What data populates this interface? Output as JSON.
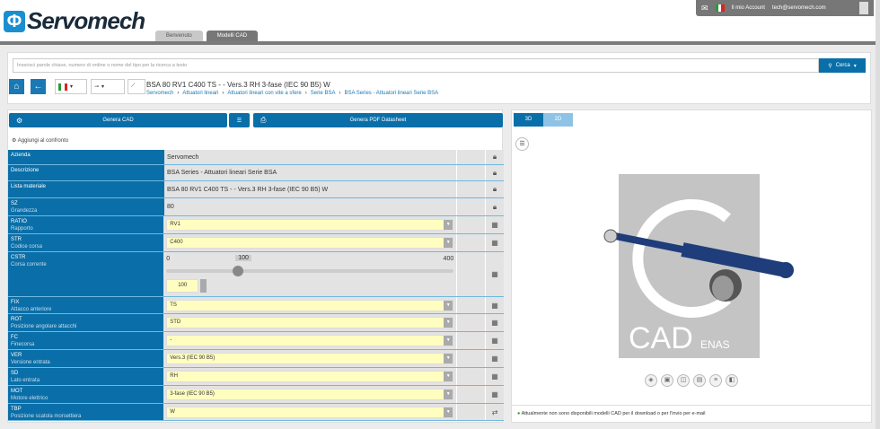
{
  "header": {
    "logo_text": "Servomech",
    "tabs": [
      "Benvenuto",
      "Modelli CAD"
    ],
    "account_label": "Il mio Account",
    "email": "tech@servomech.com"
  },
  "search": {
    "placeholder": "Inserisci parole chiave, numero di ordine o nome del tipo per la ricerca a testo",
    "button": "Cerca"
  },
  "product": {
    "title": "BSA 80 RV1 C400 TS - - Vers.3 RH 3-fase (IEC 90 B5) W",
    "breadcrumb": [
      "Servomech",
      "Attuatori lineari",
      "Attuatori lineari con vite a sfere",
      "Serie BSA",
      "BSA Series - Attuatori lineari Serie BSA"
    ]
  },
  "actions": {
    "generate_cad": "Genera CAD",
    "generate_pdf": "Genera PDF Datasheet",
    "compare": "Aggiungi al confronto"
  },
  "rows": [
    {
      "code": "Azienda",
      "desc": "",
      "value": "Servomech",
      "type": "locked"
    },
    {
      "code": "Descrizione",
      "desc": "",
      "value": "BSA Series - Attuatori lineari Serie BSA",
      "type": "locked"
    },
    {
      "code": "Lista materiale",
      "desc": "",
      "value": "BSA 80 RV1 C400 TS - - Vers.3 RH 3-fase (IEC 90 B5) W",
      "type": "locked"
    },
    {
      "code": "SZ",
      "desc": "Grandezza",
      "value": "80",
      "type": "locked"
    },
    {
      "code": "RATIO",
      "desc": "Rapporto",
      "value": "RV1",
      "type": "select"
    },
    {
      "code": "STR",
      "desc": "Codice corsa",
      "value": "C400",
      "type": "select"
    },
    {
      "code": "CSTR",
      "desc": "Corsa corrente",
      "value": "100",
      "type": "slider",
      "min": "0",
      "max": "400"
    },
    {
      "code": "FIX",
      "desc": "Attacco anteriore",
      "value": "TS",
      "type": "select"
    },
    {
      "code": "ROT",
      "desc": "Posizione angolare attacchi",
      "value": "STD",
      "type": "select"
    },
    {
      "code": "FC",
      "desc": "Finecorsa",
      "value": "-",
      "type": "select"
    },
    {
      "code": "VER",
      "desc": "Versione entrata",
      "value": "Vers.3 (IEC 90 B5)",
      "type": "select"
    },
    {
      "code": "SD",
      "desc": "Lato entrata",
      "value": "RH",
      "type": "select"
    },
    {
      "code": "MOT",
      "desc": "Motore elettrico",
      "value": "3-fase (IEC 90 B5)",
      "type": "select"
    },
    {
      "code": "TBP",
      "desc": "Posizione scatola morsettiera",
      "value": "W",
      "type": "select"
    }
  ],
  "viewer": {
    "tabs": [
      "3D",
      "2D"
    ],
    "watermark": "CAD ENAS",
    "message": "Attualmente non sono disponibili modelli CAD per il download o per l'invio per e-mail"
  },
  "colors": {
    "primary": "#0a6fa8",
    "select_bg": "#fffdc0"
  }
}
